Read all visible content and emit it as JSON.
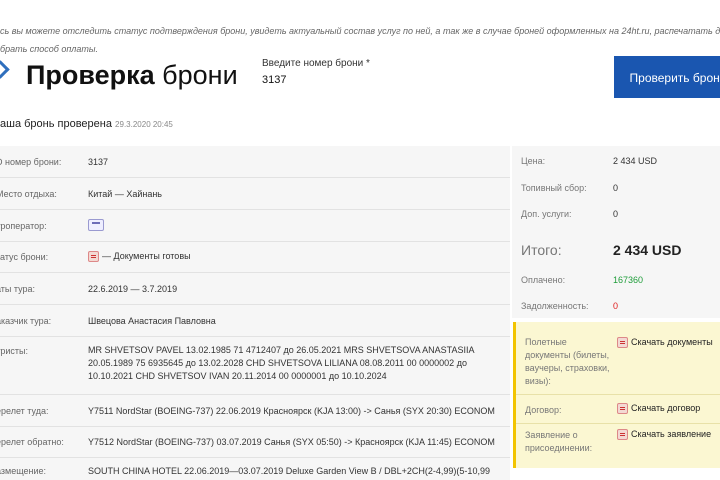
{
  "intro": {
    "line1": "сь вы можете отследить статус подтверждения брони, увидеть актуальный состав услуг по ней, а так же в случае броней оформленных на 24ht.ru, распечатать договор и",
    "line2": "брать способ оплаты."
  },
  "header": {
    "title_bold": "Проверка",
    "title_rest": " брони",
    "input_label": "Введите номер брони *",
    "input_value": "3137",
    "button_label": "Проверить брони"
  },
  "status": {
    "text": "аша бронь проверена",
    "timestamp": "29.3.2020 20:45"
  },
  "details": [
    {
      "label": "D номер брони:",
      "value": "3137"
    },
    {
      "label": "Место отдыха:",
      "value": "Китай — Хайнань"
    },
    {
      "label": "уроператор:",
      "value": ""
    },
    {
      "label": "татус брони:",
      "value": "— Документы готовы"
    },
    {
      "label": "аты тура:",
      "value": "22.6.2019 — 3.7.2019"
    },
    {
      "label": "аказчик тура:",
      "value": "Швецова Анастасия Павловна"
    },
    {
      "label": "уристы:",
      "value": "MR SHVETSOV PAVEL 13.02.1985 71 4712407 до 26.05.2021 MRS SHVETSOVA ANASTASIIA 20.05.1989 75 6935645 до 13.02.2028 CHD SHVETSOVA LILIANA 08.08.2011 00 0000002 до 10.10.2021 CHD SHVETSOV IVAN 20.11.2014 00 0000001 до 10.10.2024"
    },
    {
      "label": "ерелет туда:",
      "value": "Y7511 NordStar (BOEING-737) 22.06.2019 Красноярск (KJA 13:00) -> Санья (SYX 20:30) ECONOM"
    },
    {
      "label": "ерелет обратно:",
      "value": "Y7512 NordStar (BOEING-737) 03.07.2019 Санья (SYX 05:50) -> Красноярск (KJA 11:45) ECONOM"
    },
    {
      "label": "азмещение:",
      "value": "SOUTH CHINA HOTEL 22.06.2019—03.07.2019 Deluxe Garden View B / DBL+2CH(2-4,99)(5-10,99"
    }
  ],
  "summary": {
    "price_label": "Цена:",
    "price_value": "2 434 USD",
    "fuel_label": "Топивный сбор:",
    "fuel_value": "0",
    "extra_label": "Доп. услуги:",
    "extra_value": "0",
    "total_label": "Итого:",
    "total_value": "2 434 USD",
    "paid_label": "Оплачено:",
    "paid_value": "167360",
    "debt_label": "Задолженность:",
    "debt_value": "0"
  },
  "documents": {
    "flight_label": "Полетные документы (билеты, ваучеры, страховки, визы):",
    "flight_link": "Скачать документы",
    "contract_label": "Договор:",
    "contract_link": "Скачать договор",
    "application_label": "Заявление о присоединении:",
    "application_link": "Скачать заявление"
  },
  "colors": {
    "accent": "#1a56b0",
    "paid": "#1f9d3a",
    "debt": "#e02020",
    "notice": "#fbf7d2"
  }
}
